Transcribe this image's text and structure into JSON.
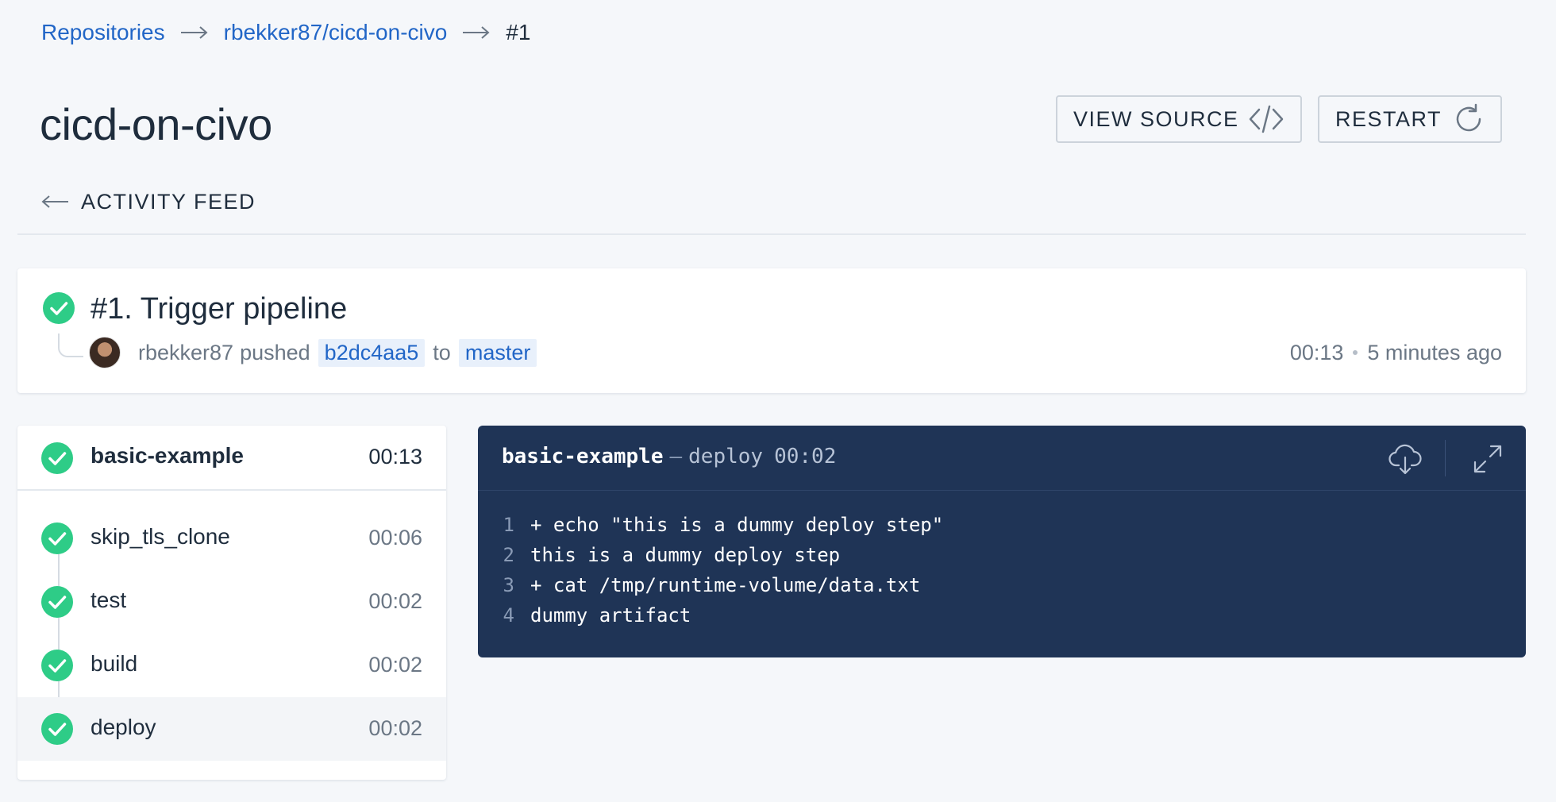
{
  "breadcrumb": {
    "repositories": "Repositories",
    "repo": "rbekker87/cicd-on-civo",
    "build": "#1"
  },
  "title": "cicd-on-civo",
  "buttons": {
    "view_source": "VIEW SOURCE",
    "restart": "RESTART"
  },
  "activity_feed": "ACTIVITY FEED",
  "pipeline": {
    "title": "#1. Trigger pipeline",
    "author": "rbekker87",
    "action": "pushed",
    "commit": "b2dc4aa5",
    "to": "to",
    "branch": "master",
    "duration": "00:13",
    "time_ago": "5 minutes ago"
  },
  "stage": {
    "name": "basic-example",
    "duration": "00:13",
    "steps": [
      {
        "name": "skip_tls_clone",
        "duration": "00:06"
      },
      {
        "name": "test",
        "duration": "00:02"
      },
      {
        "name": "build",
        "duration": "00:02"
      },
      {
        "name": "deploy",
        "duration": "00:02"
      }
    ]
  },
  "log": {
    "job": "basic-example",
    "separator": "—",
    "step": "deploy",
    "duration": "00:02",
    "lines": [
      {
        "num": "1",
        "text": "+ echo \"this is a dummy deploy step\""
      },
      {
        "num": "2",
        "text": "this is a dummy deploy step"
      },
      {
        "num": "3",
        "text": "+ cat /tmp/runtime-volume/data.txt"
      },
      {
        "num": "4",
        "text": "dummy artifact"
      }
    ]
  },
  "colors": {
    "success": "#2ecc87",
    "link": "#2266c7",
    "log_bg": "#1f3456"
  },
  "icons": {
    "success": "check-circle-icon",
    "view_source": "code-icon",
    "restart": "refresh-icon",
    "back": "arrow-left-icon",
    "download": "cloud-download-icon",
    "expand": "expand-icon"
  }
}
